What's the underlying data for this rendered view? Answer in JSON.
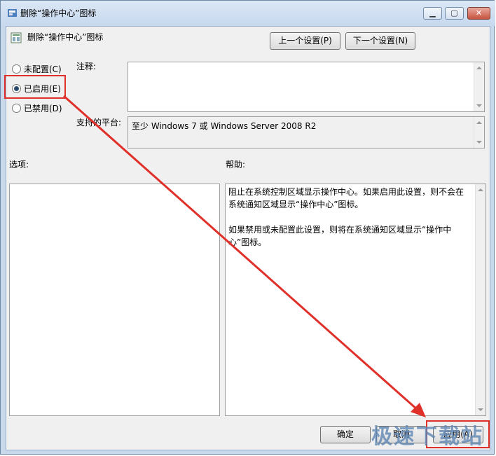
{
  "window": {
    "title": "删除“操作中心”图标"
  },
  "header": {
    "policy_title": "删除“操作中心”图标",
    "prev_button": "上一个设置(P)",
    "next_button": "下一个设置(N)"
  },
  "radios": [
    {
      "label": "未配置(C)",
      "checked": false
    },
    {
      "label": "已启用(E)",
      "checked": true
    },
    {
      "label": "已禁用(D)",
      "checked": false
    }
  ],
  "comment": {
    "label": "注释:",
    "value": ""
  },
  "platform": {
    "label": "支持的平台:",
    "value": "至少 Windows 7 或 Windows Server 2008 R2"
  },
  "options": {
    "label": "选项:"
  },
  "help": {
    "label": "帮助:",
    "para1": "阻止在系统控制区域显示操作中心。如果启用此设置，则不会在系统通知区域显示“操作中心”图标。",
    "para2": "如果禁用或未配置此设置，则将在系统通知区域显示“操作中心”图标。"
  },
  "footer": {
    "ok_button": "确定",
    "cancel_button": "取消",
    "apply_button": "应用(A)"
  },
  "watermark": "极速下载站",
  "colors": {
    "annotation_red": "#e0302a"
  }
}
